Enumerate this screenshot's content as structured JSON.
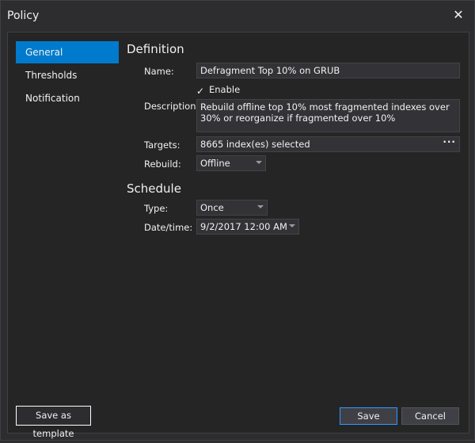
{
  "window": {
    "title": "Policy",
    "close_glyph": "✕"
  },
  "nav": {
    "items": [
      {
        "label": "General",
        "active": true
      },
      {
        "label": "Thresholds",
        "active": false
      },
      {
        "label": "Notification",
        "active": false
      }
    ]
  },
  "definition": {
    "heading": "Definition",
    "name_label": "Name:",
    "name_value": "Defragment Top 10% on GRUB",
    "enable_label": "Enable",
    "enable_checked": true,
    "description_label": "Description:",
    "description_value": "Rebuild offline top 10% most fragmented indexes over 30% or reorganize if fragmented over 10%",
    "targets_label": "Targets:",
    "targets_value": "8665 index(es) selected",
    "targets_more": "···",
    "rebuild_label": "Rebuild:",
    "rebuild_value": "Offline"
  },
  "schedule": {
    "heading": "Schedule",
    "type_label": "Type:",
    "type_value": "Once",
    "datetime_label": "Date/time:",
    "datetime_value": "9/2/2017 12:00 AM"
  },
  "buttons": {
    "save_template": "Save as template",
    "save": "Save",
    "cancel": "Cancel"
  },
  "colors": {
    "accent": "#007acc",
    "background": "#2d2d30",
    "panel": "#252526"
  }
}
